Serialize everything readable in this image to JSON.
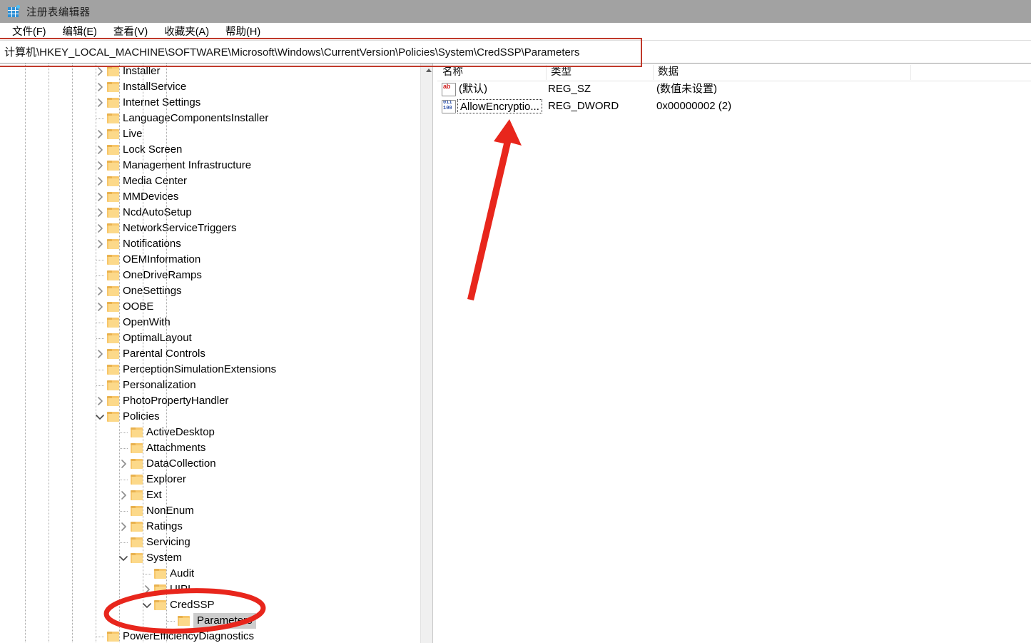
{
  "window": {
    "title": "注册表编辑器",
    "icon": "registry-editor-icon"
  },
  "menubar": {
    "items": [
      {
        "label": "文件(F)",
        "name": "menu-file"
      },
      {
        "label": "编辑(E)",
        "name": "menu-edit"
      },
      {
        "label": "查看(V)",
        "name": "menu-view"
      },
      {
        "label": "收藏夹(A)",
        "name": "menu-favorites"
      },
      {
        "label": "帮助(H)",
        "name": "menu-help"
      }
    ]
  },
  "address_bar": {
    "value": "计算机\\HKEY_LOCAL_MACHINE\\SOFTWARE\\Microsoft\\Windows\\CurrentVersion\\Policies\\System\\CredSSP\\Parameters"
  },
  "tree": {
    "scroll_up_icon": "scroll-up-arrow-icon",
    "nodes": [
      {
        "label": "Installer",
        "depth": 4,
        "expander": "collapsed",
        "selected": false
      },
      {
        "label": "InstallService",
        "depth": 4,
        "expander": "collapsed",
        "selected": false
      },
      {
        "label": "Internet Settings",
        "depth": 4,
        "expander": "collapsed",
        "selected": false
      },
      {
        "label": "LanguageComponentsInstaller",
        "depth": 4,
        "expander": "none",
        "selected": false
      },
      {
        "label": "Live",
        "depth": 4,
        "expander": "collapsed",
        "selected": false
      },
      {
        "label": "Lock Screen",
        "depth": 4,
        "expander": "collapsed",
        "selected": false
      },
      {
        "label": "Management Infrastructure",
        "depth": 4,
        "expander": "collapsed",
        "selected": false
      },
      {
        "label": "Media Center",
        "depth": 4,
        "expander": "collapsed",
        "selected": false
      },
      {
        "label": "MMDevices",
        "depth": 4,
        "expander": "collapsed",
        "selected": false
      },
      {
        "label": "NcdAutoSetup",
        "depth": 4,
        "expander": "collapsed",
        "selected": false
      },
      {
        "label": "NetworkServiceTriggers",
        "depth": 4,
        "expander": "collapsed",
        "selected": false
      },
      {
        "label": "Notifications",
        "depth": 4,
        "expander": "collapsed",
        "selected": false
      },
      {
        "label": "OEMInformation",
        "depth": 4,
        "expander": "none",
        "selected": false
      },
      {
        "label": "OneDriveRamps",
        "depth": 4,
        "expander": "none",
        "selected": false
      },
      {
        "label": "OneSettings",
        "depth": 4,
        "expander": "collapsed",
        "selected": false
      },
      {
        "label": "OOBE",
        "depth": 4,
        "expander": "collapsed",
        "selected": false
      },
      {
        "label": "OpenWith",
        "depth": 4,
        "expander": "none",
        "selected": false
      },
      {
        "label": "OptimalLayout",
        "depth": 4,
        "expander": "none",
        "selected": false
      },
      {
        "label": "Parental Controls",
        "depth": 4,
        "expander": "collapsed",
        "selected": false
      },
      {
        "label": "PerceptionSimulationExtensions",
        "depth": 4,
        "expander": "none",
        "selected": false
      },
      {
        "label": "Personalization",
        "depth": 4,
        "expander": "none",
        "selected": false
      },
      {
        "label": "PhotoPropertyHandler",
        "depth": 4,
        "expander": "collapsed",
        "selected": false
      },
      {
        "label": "Policies",
        "depth": 4,
        "expander": "expanded",
        "selected": false
      },
      {
        "label": "ActiveDesktop",
        "depth": 5,
        "expander": "none",
        "selected": false
      },
      {
        "label": "Attachments",
        "depth": 5,
        "expander": "none",
        "selected": false
      },
      {
        "label": "DataCollection",
        "depth": 5,
        "expander": "collapsed",
        "selected": false
      },
      {
        "label": "Explorer",
        "depth": 5,
        "expander": "none",
        "selected": false
      },
      {
        "label": "Ext",
        "depth": 5,
        "expander": "collapsed",
        "selected": false
      },
      {
        "label": "NonEnum",
        "depth": 5,
        "expander": "none",
        "selected": false
      },
      {
        "label": "Ratings",
        "depth": 5,
        "expander": "collapsed",
        "selected": false
      },
      {
        "label": "Servicing",
        "depth": 5,
        "expander": "none",
        "selected": false
      },
      {
        "label": "System",
        "depth": 5,
        "expander": "expanded",
        "selected": false
      },
      {
        "label": "Audit",
        "depth": 6,
        "expander": "none",
        "selected": false
      },
      {
        "label": "UIPI",
        "depth": 6,
        "expander": "collapsed",
        "selected": false
      },
      {
        "label": "CredSSP",
        "depth": 6,
        "expander": "expanded",
        "selected": false
      },
      {
        "label": "Parameters",
        "depth": 7,
        "expander": "none",
        "selected": true
      },
      {
        "label": "PowerEfficiencyDiagnostics",
        "depth": 4,
        "expander": "none",
        "selected": false
      }
    ]
  },
  "values_list": {
    "columns": [
      "名称",
      "类型",
      "数据"
    ],
    "rows": [
      {
        "name": "(默认)",
        "type": "REG_SZ",
        "data": "(数值未设置)",
        "icon": "string-value-icon",
        "focused": false
      },
      {
        "name": "AllowEncryptio...",
        "type": "REG_DWORD",
        "data": "0x00000002 (2)",
        "icon": "dword-value-icon",
        "focused": true
      }
    ]
  },
  "annotations": {
    "address_highlight_rect": {
      "name": "address-bar-highlight-rect",
      "color": "#c0392b"
    },
    "arrow": {
      "name": "red-arrow-annotation",
      "color": "#e8261c"
    },
    "ellipse": {
      "name": "red-ellipse-annotation",
      "color": "#e8261c"
    }
  }
}
